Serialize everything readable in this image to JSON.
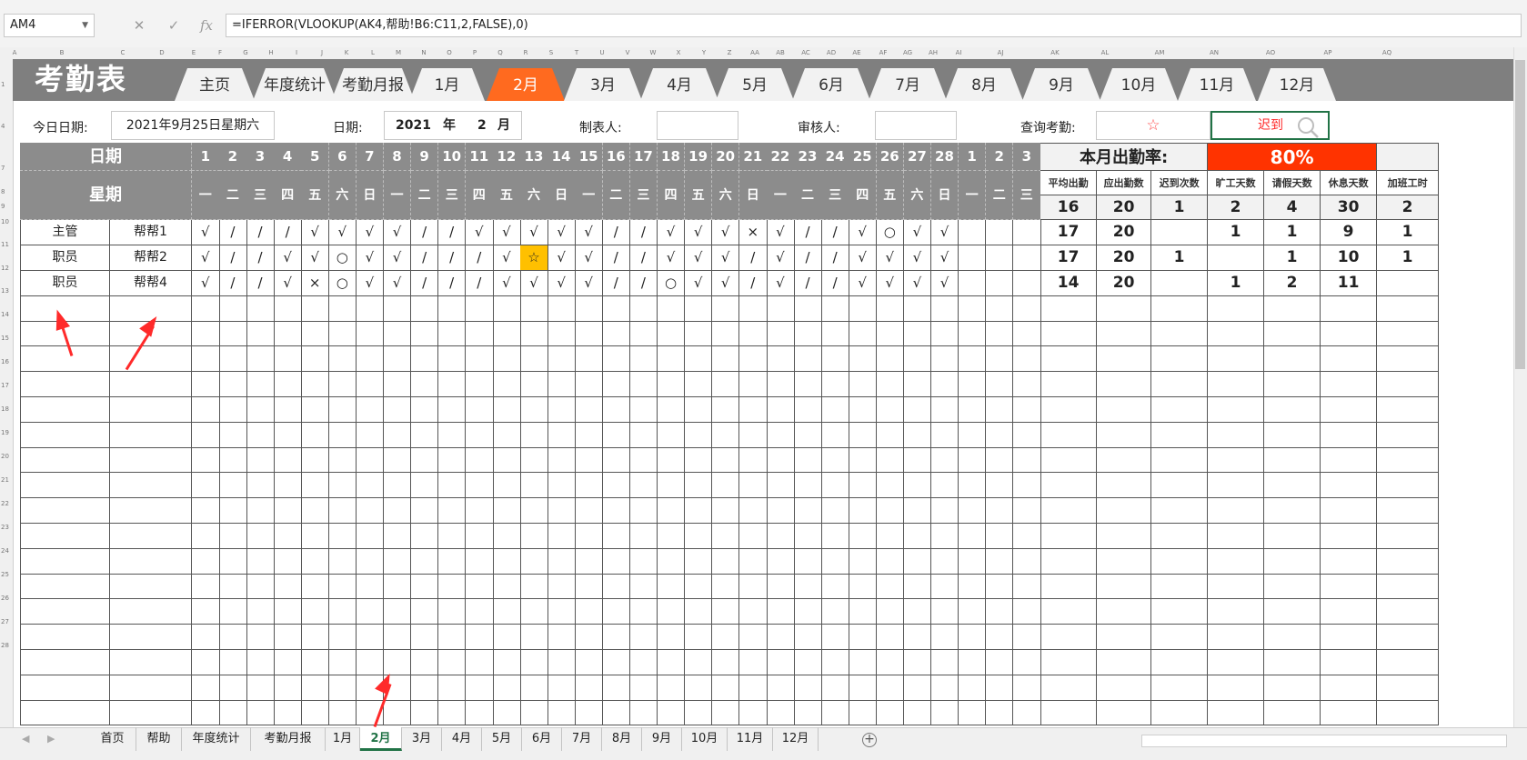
{
  "formula_bar": {
    "name_box": "AM4",
    "cancel_icon": "✕",
    "enter_icon": "✓",
    "fx_icon": "fx",
    "formula": "=IFERROR(VLOOKUP(AK4,帮助!B6:C11,2,FALSE),0)"
  },
  "column_letters": [
    "A",
    "B",
    "C",
    "D",
    "E",
    "F",
    "G",
    "H",
    "I",
    "J",
    "K",
    "L",
    "M",
    "N",
    "O",
    "P",
    "Q",
    "R",
    "S",
    "T",
    "U",
    "V",
    "W",
    "X",
    "Y",
    "Z",
    "AA",
    "AB",
    "AC",
    "AD",
    "AE",
    "AF",
    "AG",
    "AH",
    "AI",
    "AJ",
    "AK",
    "AL",
    "AM",
    "AN",
    "AO",
    "AP",
    "AQ"
  ],
  "row_numbers": [
    "1",
    "4",
    "7",
    "8",
    "9",
    "10",
    "11",
    "12",
    "13",
    "14",
    "15",
    "16",
    "17",
    "18",
    "19",
    "20",
    "21",
    "22",
    "23",
    "24",
    "25",
    "26",
    "27",
    "28"
  ],
  "banner": {
    "title": "考勤表",
    "tabs": [
      "主页",
      "年度统计",
      "考勤月报",
      "1月",
      "2月",
      "3月",
      "4月",
      "5月",
      "6月",
      "7月",
      "8月",
      "9月",
      "10月",
      "11月",
      "12月"
    ],
    "active_tab": "2月"
  },
  "info": {
    "today_label": "今日日期:",
    "today_value": "2021年9月25日星期六",
    "date_label": "日期:",
    "year": "2021",
    "year_unit": "年",
    "month": "2",
    "month_unit": "月",
    "maker_label": "制表人:",
    "maker_value": "",
    "reviewer_label": "审核人:",
    "reviewer_value": "",
    "query_label": "查询考勤:",
    "query_symbol": "☆",
    "query_result": "迟到",
    "search_icon": "search-icon"
  },
  "table": {
    "date_header": "日期",
    "weekday_header": "星期",
    "days": [
      "1",
      "2",
      "3",
      "4",
      "5",
      "6",
      "7",
      "8",
      "9",
      "10",
      "11",
      "12",
      "13",
      "14",
      "15",
      "16",
      "17",
      "18",
      "19",
      "20",
      "21",
      "22",
      "23",
      "24",
      "25",
      "26",
      "27",
      "28",
      "1",
      "2",
      "3"
    ],
    "weekdays": [
      "一",
      "二",
      "三",
      "四",
      "五",
      "六",
      "日",
      "一",
      "二",
      "三",
      "四",
      "五",
      "六",
      "日",
      "一",
      "二",
      "三",
      "四",
      "五",
      "六",
      "日",
      "一",
      "二",
      "三",
      "四",
      "五",
      "六",
      "日",
      "一",
      "二",
      "三"
    ],
    "rows": [
      {
        "role": "主管",
        "name": "帮帮1",
        "marks": [
          "√",
          "/",
          "/",
          "/",
          "√",
          "√",
          "√",
          "√",
          "/",
          "/",
          "√",
          "√",
          "√",
          "√",
          "√",
          "/",
          "/",
          "√",
          "√",
          "√",
          "×",
          "√",
          "/",
          "/",
          "√",
          "○",
          "√",
          "√",
          "",
          "",
          ""
        ]
      },
      {
        "role": "职员",
        "name": "帮帮2",
        "marks": [
          "√",
          "/",
          "/",
          "√",
          "√",
          "○",
          "√",
          "√",
          "/",
          "/",
          "/",
          "√",
          "☆",
          "√",
          "√",
          "/",
          "/",
          "√",
          "√",
          "√",
          "/",
          "√",
          "/",
          "/",
          "√",
          "√",
          "√",
          "√",
          "",
          "",
          ""
        ]
      },
      {
        "role": "职员",
        "name": "帮帮4",
        "marks": [
          "√",
          "/",
          "/",
          "√",
          "×",
          "○",
          "√",
          "√",
          "/",
          "/",
          "/",
          "√",
          "√",
          "√",
          "√",
          "/",
          "/",
          "○",
          "√",
          "√",
          "/",
          "√",
          "/",
          "/",
          "√",
          "√",
          "√",
          "√",
          "",
          "",
          ""
        ]
      }
    ],
    "highlight": {
      "row": 1,
      "col": 12,
      "color": "#ffc000"
    },
    "empty_rows": 17
  },
  "stats": {
    "rate_label": "本月出勤率:",
    "rate_value": "80%",
    "rate_color": "#ff3300",
    "headers": [
      "平均出勤",
      "应出勤数",
      "迟到次数",
      "旷工天数",
      "请假天数",
      "休息天数",
      "加班工时"
    ],
    "totals": [
      "16",
      "20",
      "1",
      "2",
      "4",
      "30",
      "2"
    ],
    "rows": [
      [
        "17",
        "20",
        "",
        "1",
        "1",
        "9",
        "1"
      ],
      [
        "17",
        "20",
        "1",
        "",
        "1",
        "10",
        "1"
      ],
      [
        "14",
        "20",
        "",
        "1",
        "2",
        "11",
        ""
      ]
    ]
  },
  "sheet_tabs": [
    "首页",
    "帮助",
    "年度统计",
    "考勤月报",
    "1月",
    "2月",
    "3月",
    "4月",
    "5月",
    "6月",
    "7月",
    "8月",
    "9月",
    "10月",
    "11月",
    "12月"
  ],
  "active_sheet": "2月",
  "add_sheet": "+",
  "accent_green": "#217346",
  "arrow_color": "#ff2a2a"
}
